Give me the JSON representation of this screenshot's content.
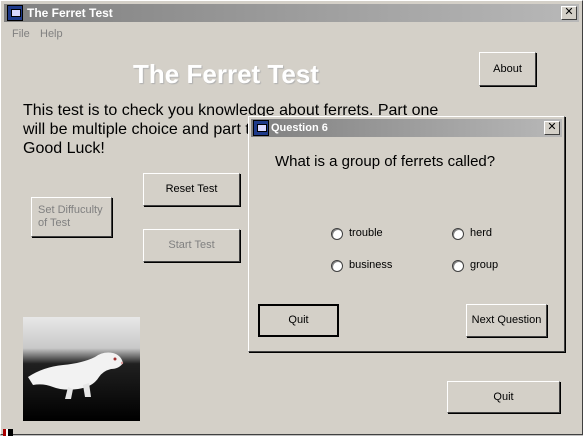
{
  "window": {
    "title": "The Ferret Test",
    "icon": "app-window-icon",
    "close_label": "✕"
  },
  "menu": {
    "items": [
      "File",
      "Help"
    ]
  },
  "main": {
    "heading": "The Ferret Test",
    "intro_text": "This test is to check you knowledge about ferrets. Part one will be multiple choice and part tw",
    "intro_text_line3": "Good Luck!",
    "buttons": {
      "about": "About",
      "reset": "Reset Test",
      "set_difficulty": "Set Diffuculty of Test",
      "start": "Start Test",
      "quit": "Quit"
    },
    "photo": "white-ferret-photo"
  },
  "dialog": {
    "title": "Question 6",
    "close_label": "✕",
    "question": "What is a group of ferrets called?",
    "options": [
      "trouble",
      "herd",
      "business",
      "group"
    ],
    "buttons": {
      "quit": "Quit",
      "next": "Next Question"
    }
  },
  "colors": {
    "face": "#d4d0c8",
    "titlebar_inactive_start": "#808080",
    "titlebar_inactive_end": "#b8b8b8",
    "heading": "#ffffff"
  }
}
